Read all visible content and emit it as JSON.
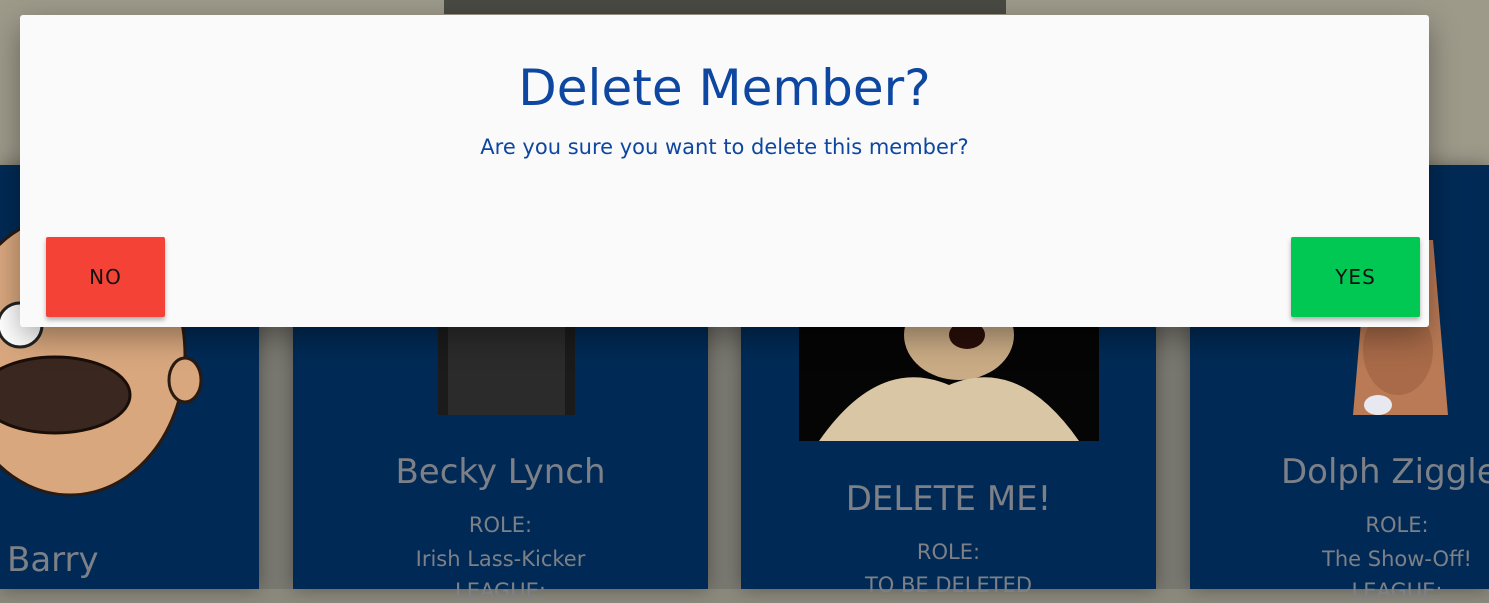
{
  "modal": {
    "title": "Delete Member?",
    "message": "Are you sure you want to delete this member?",
    "no_label": "NO",
    "yes_label": "YES",
    "no_color": "#f44336",
    "yes_color": "#00c853",
    "text_color": "#0d47a1"
  },
  "cards": [
    {
      "name": "Barry"
    },
    {
      "name": "Becky Lynch",
      "role_heading": "ROLE:",
      "role": "Irish Lass-Kicker",
      "league_heading": "LEAGUE:"
    },
    {
      "name": "DELETE ME!",
      "role_heading": "ROLE:",
      "role": "TO BE DELETED"
    },
    {
      "name": "Dolph Ziggle",
      "role_heading": "ROLE:",
      "role": "The Show-Off!",
      "league_heading": "LEAGUE:"
    }
  ],
  "colors": {
    "card_background": "#002a55",
    "page_dim": "#8c8a7d"
  }
}
